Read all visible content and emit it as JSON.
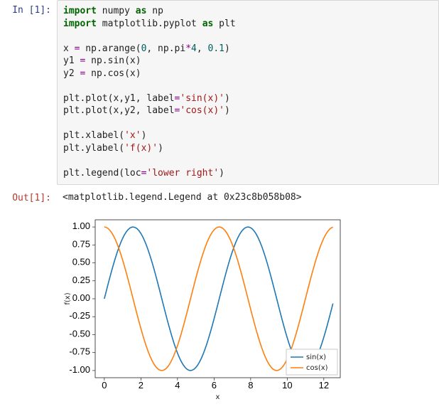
{
  "in_prompt": "In [1]:",
  "out_prompt": "Out[1]:",
  "code": {
    "l1_import": "import",
    "l1_rest": " numpy ",
    "l1_as": "as",
    "l1_np": " np",
    "l2_import": "import",
    "l2_rest": " matplotlib.pyplot ",
    "l2_as": "as",
    "l2_plt": " plt",
    "l4_a": "x ",
    "l4_eq": "=",
    "l4_b": " np.arange(",
    "l4_n0": "0",
    "l4_c": ", np.pi",
    "l4_mul": "*",
    "l4_n4": "4",
    "l4_d": ", ",
    "l4_n01": "0.1",
    "l4_e": ")",
    "l5_a": "y1 ",
    "l5_eq": "=",
    "l5_b": " np.sin(x)",
    "l6_a": "y2 ",
    "l6_eq": "=",
    "l6_b": " np.cos(x)",
    "l8_a": "plt.plot(x,y1, label",
    "l8_eq": "=",
    "l8_s": "'sin(x)'",
    "l8_b": ")",
    "l9_a": "plt.plot(x,y2, label",
    "l9_eq": "=",
    "l9_s": "'cos(x)'",
    "l9_b": ")",
    "l11_a": "plt.xlabel(",
    "l11_s": "'x'",
    "l11_b": ")",
    "l12_a": "plt.ylabel(",
    "l12_s": "'f(x)'",
    "l12_b": ")",
    "l14_a": "plt.legend(loc",
    "l14_eq": "=",
    "l14_s": "'lower right'",
    "l14_b": ")"
  },
  "output_text": "<matplotlib.legend.Legend at 0x23c8b058b08>",
  "chart_data": {
    "type": "line",
    "xlabel": "x",
    "ylabel": "f(x)",
    "xlim": [
      -0.5,
      12.9
    ],
    "ylim": [
      -1.1,
      1.1
    ],
    "xticks": [
      0,
      2,
      4,
      6,
      8,
      10,
      12
    ],
    "yticks": [
      -1.0,
      -0.75,
      -0.5,
      -0.25,
      0.0,
      0.25,
      0.5,
      0.75,
      1.0
    ],
    "ytick_labels": [
      "-1.00",
      "-0.75",
      "-0.50",
      "-0.25",
      "0.00",
      "0.25",
      "0.50",
      "0.75",
      "1.00"
    ],
    "legend_loc": "lower right",
    "series": [
      {
        "name": "sin(x)",
        "color": "#1f77b4",
        "x": [
          0.0,
          0.1,
          0.2,
          0.3,
          0.4,
          0.5,
          0.6,
          0.7,
          0.8,
          0.9,
          1.0,
          1.1,
          1.2,
          1.3,
          1.4,
          1.5,
          1.6,
          1.7,
          1.8,
          1.9,
          2.0,
          2.1,
          2.2,
          2.3,
          2.4,
          2.5,
          2.6,
          2.7,
          2.8,
          2.9,
          3.0,
          3.1,
          3.2,
          3.3,
          3.4,
          3.5,
          3.6,
          3.7,
          3.8,
          3.9,
          4.0,
          4.1,
          4.2,
          4.3,
          4.4,
          4.5,
          4.6,
          4.7,
          4.8,
          4.9,
          5.0,
          5.1,
          5.2,
          5.3,
          5.4,
          5.5,
          5.6,
          5.7,
          5.8,
          5.9,
          6.0,
          6.1,
          6.2,
          6.3,
          6.4,
          6.5,
          6.6,
          6.7,
          6.8,
          6.9,
          7.0,
          7.1,
          7.2,
          7.3,
          7.4,
          7.5,
          7.6,
          7.7,
          7.8,
          7.9,
          8.0,
          8.1,
          8.2,
          8.3,
          8.4,
          8.5,
          8.6,
          8.7,
          8.8,
          8.9,
          9.0,
          9.1,
          9.2,
          9.3,
          9.4,
          9.5,
          9.6,
          9.7,
          9.8,
          9.9,
          10.0,
          10.1,
          10.2,
          10.3,
          10.4,
          10.5,
          10.6,
          10.7,
          10.8,
          10.9,
          11.0,
          11.1,
          11.2,
          11.3,
          11.4,
          11.5,
          11.6,
          11.7,
          11.8,
          11.9,
          12.0,
          12.1,
          12.2,
          12.3,
          12.4,
          12.5
        ],
        "y": [
          0.0,
          0.0998,
          0.1987,
          0.2955,
          0.3894,
          0.4794,
          0.5646,
          0.6442,
          0.7174,
          0.7833,
          0.8415,
          0.8912,
          0.932,
          0.9636,
          0.9854,
          0.9975,
          0.9996,
          0.9917,
          0.9738,
          0.9463,
          0.9093,
          0.8632,
          0.8085,
          0.7457,
          0.6755,
          0.5985,
          0.5155,
          0.4274,
          0.335,
          0.2392,
          0.1411,
          0.0416,
          -0.0584,
          -0.1577,
          -0.2555,
          -0.3508,
          -0.4425,
          -0.5298,
          -0.6119,
          -0.6878,
          -0.7568,
          -0.8183,
          -0.8716,
          -0.9162,
          -0.9516,
          -0.9775,
          -0.9937,
          -0.9999,
          -0.9962,
          -0.9825,
          -0.9589,
          -0.9258,
          -0.8835,
          -0.8323,
          -0.7728,
          -0.7055,
          -0.6313,
          -0.5507,
          -0.4646,
          -0.3739,
          -0.2794,
          -0.1822,
          -0.0831,
          0.0168,
          0.1165,
          0.2151,
          0.3115,
          0.4048,
          0.4941,
          0.5784,
          0.657,
          0.729,
          0.7937,
          0.8504,
          0.8987,
          0.938,
          0.9679,
          0.9882,
          0.9985,
          0.9989,
          0.9894,
          0.9699,
          0.9407,
          0.9022,
          0.8546,
          0.7985,
          0.7344,
          0.663,
          0.5849,
          0.501,
          0.4121,
          0.3191,
          0.2229,
          0.1245,
          0.0248,
          -0.0752,
          -0.1743,
          -0.2718,
          -0.3665,
          -0.4575,
          -0.544,
          -0.6251,
          -0.6999,
          -0.7675,
          -0.8274,
          -0.8789,
          -0.9217,
          -0.9551,
          -0.9791,
          -0.9933,
          -0.9978,
          -0.9923,
          -0.977,
          -0.9519,
          -0.9175,
          -0.8739,
          -0.8218,
          -0.7614,
          -0.6935,
          -0.6186,
          -0.5366,
          -0.4499,
          -0.3582,
          -0.2632,
          -0.1656,
          -0.0664
        ]
      },
      {
        "name": "cos(x)",
        "color": "#ff7f0e",
        "x": [
          0.0,
          0.1,
          0.2,
          0.3,
          0.4,
          0.5,
          0.6,
          0.7,
          0.8,
          0.9,
          1.0,
          1.1,
          1.2,
          1.3,
          1.4,
          1.5,
          1.6,
          1.7,
          1.8,
          1.9,
          2.0,
          2.1,
          2.2,
          2.3,
          2.4,
          2.5,
          2.6,
          2.7,
          2.8,
          2.9,
          3.0,
          3.1,
          3.2,
          3.3,
          3.4,
          3.5,
          3.6,
          3.7,
          3.8,
          3.9,
          4.0,
          4.1,
          4.2,
          4.3,
          4.4,
          4.5,
          4.6,
          4.7,
          4.8,
          4.9,
          5.0,
          5.1,
          5.2,
          5.3,
          5.4,
          5.5,
          5.6,
          5.7,
          5.8,
          5.9,
          6.0,
          6.1,
          6.2,
          6.3,
          6.4,
          6.5,
          6.6,
          6.7,
          6.8,
          6.9,
          7.0,
          7.1,
          7.2,
          7.3,
          7.4,
          7.5,
          7.6,
          7.7,
          7.8,
          7.9,
          8.0,
          8.1,
          8.2,
          8.3,
          8.4,
          8.5,
          8.6,
          8.7,
          8.8,
          8.9,
          9.0,
          9.1,
          9.2,
          9.3,
          9.4,
          9.5,
          9.6,
          9.7,
          9.8,
          9.9,
          10.0,
          10.1,
          10.2,
          10.3,
          10.4,
          10.5,
          10.6,
          10.7,
          10.8,
          10.9,
          11.0,
          11.1,
          11.2,
          11.3,
          11.4,
          11.5,
          11.6,
          11.7,
          11.8,
          11.9,
          12.0,
          12.1,
          12.2,
          12.3,
          12.4,
          12.5
        ],
        "y": [
          1.0,
          0.995,
          0.9801,
          0.9553,
          0.9211,
          0.8776,
          0.8253,
          0.7648,
          0.6967,
          0.6216,
          0.5403,
          0.4536,
          0.3624,
          0.2675,
          0.17,
          0.0707,
          -0.0292,
          -0.1288,
          -0.2272,
          -0.3233,
          -0.4161,
          -0.5048,
          -0.5885,
          -0.6663,
          -0.7374,
          -0.8011,
          -0.8569,
          -0.9041,
          -0.9422,
          -0.971,
          -0.99,
          -0.9991,
          -0.9983,
          -0.9875,
          -0.9668,
          -0.9365,
          -0.8968,
          -0.8481,
          -0.791,
          -0.7259,
          -0.6536,
          -0.5748,
          -0.4903,
          -0.4008,
          -0.3073,
          -0.2108,
          -0.1122,
          -0.0124,
          0.0875,
          0.1865,
          0.2837,
          0.378,
          0.4685,
          0.5544,
          0.6347,
          0.7087,
          0.7756,
          0.8347,
          0.8855,
          0.9275,
          0.9602,
          0.9833,
          0.9965,
          0.9999,
          0.9932,
          0.9766,
          0.9502,
          0.9144,
          0.8694,
          0.8157,
          0.7539,
          0.6845,
          0.6084,
          0.5261,
          0.4385,
          0.3466,
          0.2513,
          0.1534,
          0.054,
          -0.046,
          -0.1455,
          -0.2435,
          -0.3392,
          -0.4314,
          -0.5193,
          -0.602,
          -0.6787,
          -0.7486,
          -0.8111,
          -0.8654,
          -0.9111,
          -0.9477,
          -0.9748,
          -0.9922,
          -0.9997,
          -0.9972,
          -0.9847,
          -0.9624,
          -0.9304,
          -0.8892,
          -0.8391,
          -0.7806,
          -0.7143,
          -0.6408,
          -0.561,
          -0.4755,
          -0.3853,
          -0.2913,
          -0.1943,
          -0.0954,
          0.0044,
          0.1042,
          0.203,
          0.2997,
          0.3935,
          0.4833,
          0.5683,
          0.6476,
          0.7204,
          0.786,
          0.8439,
          0.8932,
          0.9336,
          0.9647,
          0.9862,
          0.9978
        ]
      }
    ]
  }
}
